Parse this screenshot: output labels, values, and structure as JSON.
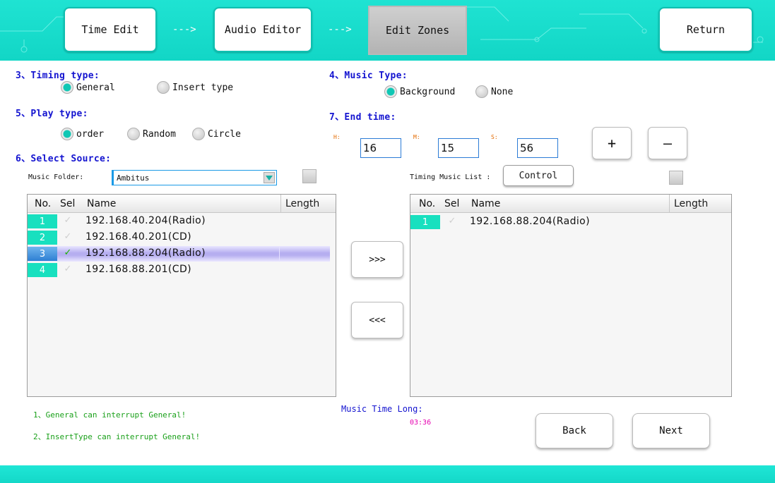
{
  "nav": {
    "tabs": [
      {
        "label": "Time Edit"
      },
      {
        "label": "Audio Editor"
      },
      {
        "label": "Edit Zones"
      },
      {
        "label": "Return"
      }
    ],
    "arrow": "--->"
  },
  "timing_type": {
    "title": "3、Timing type:",
    "options": [
      {
        "label": "General",
        "selected": true
      },
      {
        "label": "Insert type",
        "selected": false
      }
    ]
  },
  "music_type": {
    "title": "4、Music Type:",
    "options": [
      {
        "label": "Background",
        "selected": true
      },
      {
        "label": "None",
        "selected": false
      }
    ]
  },
  "play_type": {
    "title": "5、Play type:",
    "options": [
      {
        "label": "order",
        "selected": true
      },
      {
        "label": "Random",
        "selected": false
      },
      {
        "label": "Circle",
        "selected": false
      }
    ]
  },
  "end_time": {
    "title": "7、End time:",
    "h_label": "H:",
    "m_label": "M:",
    "s_label": "S:",
    "h": "16",
    "m": "15",
    "s": "56",
    "plus": "+",
    "minus": "—"
  },
  "source": {
    "title": "6、Select Source:",
    "folder_label": "Music Folder:",
    "folder_value": "Ambitus"
  },
  "timing_list": {
    "label": "Timing Music List :",
    "control_button": "Control"
  },
  "columns": {
    "no": "No.",
    "sel": "Sel",
    "name": "Name",
    "length": "Length"
  },
  "source_rows": [
    {
      "no": "1",
      "name": "192.168.40.204(Radio)",
      "checked": false
    },
    {
      "no": "2",
      "name": "192.168.40.201(CD)",
      "checked": false
    },
    {
      "no": "3",
      "name": "192.168.88.204(Radio)",
      "checked": true
    },
    {
      "no": "4",
      "name": "192.168.88.201(CD)",
      "checked": false
    }
  ],
  "timing_rows": [
    {
      "no": "1",
      "name": "192.168.88.204(Radio)",
      "checked": false
    }
  ],
  "transfer": {
    "add": ">>>",
    "remove": "<<<"
  },
  "notes": {
    "n1": "1、General can interrupt General!",
    "n2": "2、InsertType can interrupt General!"
  },
  "music_time": {
    "label": "Music Time Long:",
    "value": "03:36"
  },
  "footer": {
    "back": "Back",
    "next": "Next"
  },
  "icons": {
    "check": "check-icon",
    "caret": "dropdown-caret-icon"
  },
  "colors": {
    "accent": "#18e0bf",
    "label_blue": "#1414d0",
    "note_green": "#1aa01a",
    "time_magenta": "#e600b0"
  }
}
